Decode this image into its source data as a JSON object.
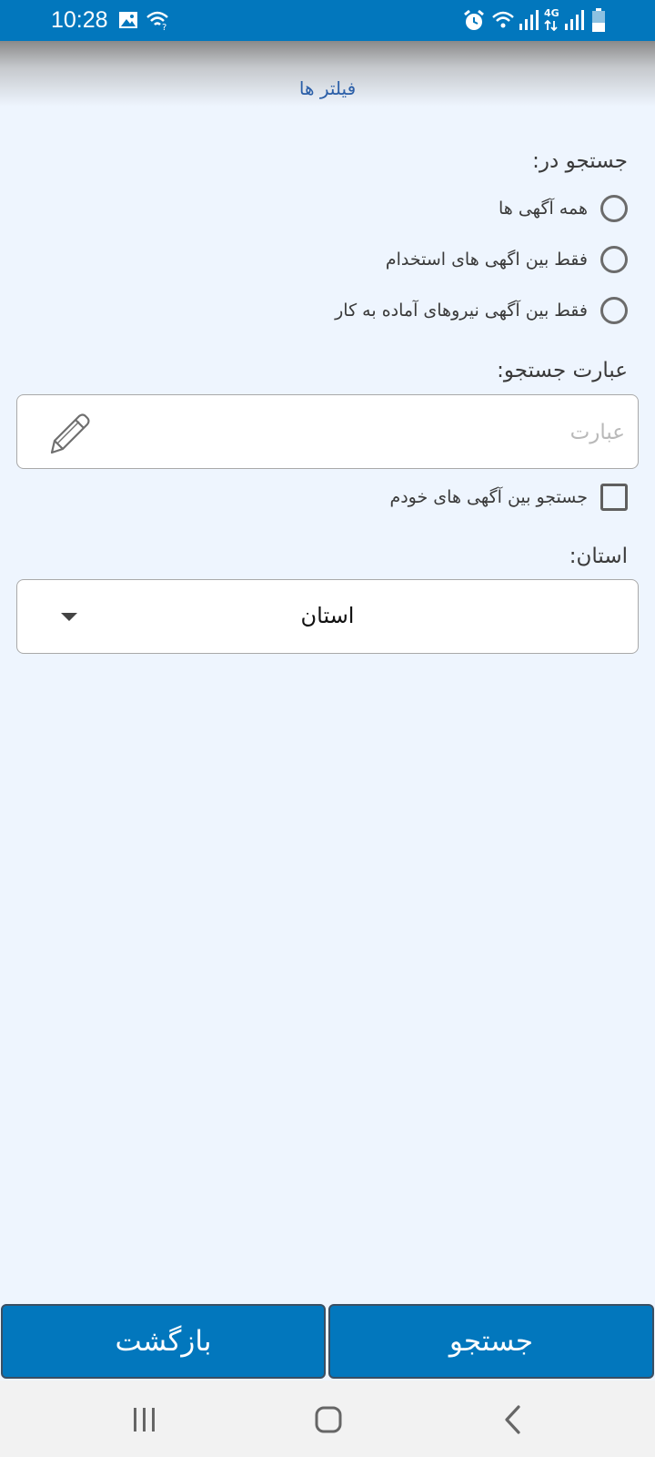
{
  "status_bar": {
    "time": "10:28",
    "network_type": "4G",
    "icons": [
      "gallery-icon",
      "wifi-call-icon",
      "alarm-icon",
      "wifi-icon",
      "signal-icon",
      "battery-icon"
    ]
  },
  "header": {
    "title": "فیلتر ها"
  },
  "search_in": {
    "label": "جستجو در:",
    "options": [
      {
        "label": "همه آگهی ها",
        "selected": false
      },
      {
        "label": "فقط بین اگهی های استخدام",
        "selected": false
      },
      {
        "label": "فقط بین آگهی نیروهای آماده به کار",
        "selected": false
      }
    ]
  },
  "search_phrase": {
    "label": "عبارت جستجو:",
    "value": "",
    "placeholder": "عبارت"
  },
  "own_ads_checkbox": {
    "label": "جستجو بین آگهی های خودم",
    "checked": false
  },
  "province": {
    "label": "استان:",
    "selected": "استان"
  },
  "buttons": {
    "search": "جستجو",
    "back": "بازگشت"
  },
  "colors": {
    "primary": "#0277bd",
    "background": "#eef5fe",
    "header_title": "#2b5fa8",
    "nav_bar": "#f2f2f2"
  }
}
